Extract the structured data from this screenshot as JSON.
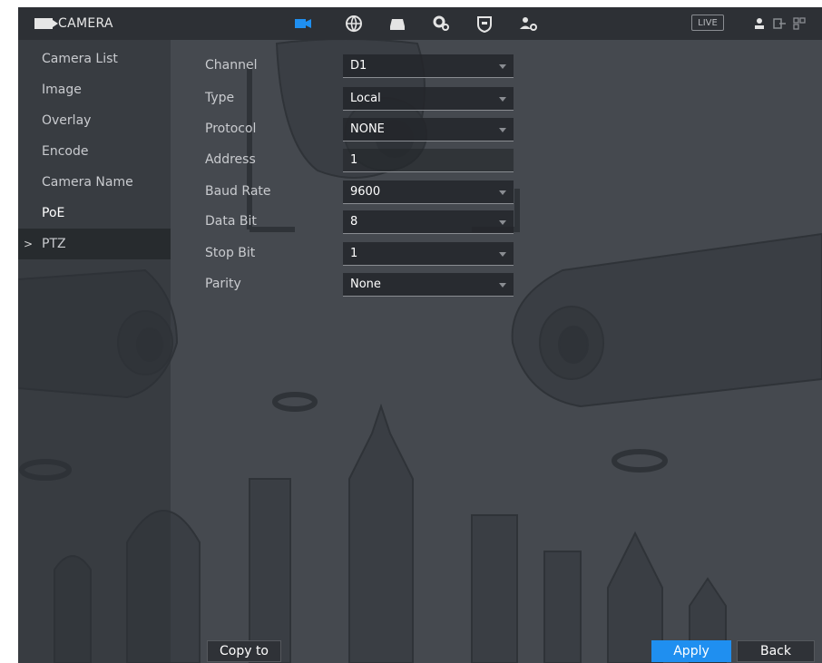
{
  "header": {
    "title": "CAMERA",
    "live_label": "LIVE"
  },
  "top_nav": [
    {
      "icon": "camera-icon",
      "active": true
    },
    {
      "icon": "network-icon"
    },
    {
      "icon": "storage-icon"
    },
    {
      "icon": "system-settings-icon"
    },
    {
      "icon": "security-shield-icon"
    },
    {
      "icon": "account-icon"
    }
  ],
  "sidebar": {
    "items": [
      {
        "label": "Camera List"
      },
      {
        "label": "Image"
      },
      {
        "label": "Overlay"
      },
      {
        "label": "Encode"
      },
      {
        "label": "Camera Name"
      },
      {
        "label": "PoE"
      },
      {
        "label": "PTZ",
        "selected": true
      }
    ],
    "selected_marker": ">"
  },
  "form": {
    "channel": {
      "label": "Channel",
      "value": "D1"
    },
    "type": {
      "label": "Type",
      "value": "Local"
    },
    "protocol": {
      "label": "Protocol",
      "value": "NONE"
    },
    "address": {
      "label": "Address",
      "value": "1"
    },
    "baud_rate": {
      "label": "Baud Rate",
      "value": "9600"
    },
    "data_bit": {
      "label": "Data Bit",
      "value": "8"
    },
    "stop_bit": {
      "label": "Stop Bit",
      "value": "1"
    },
    "parity": {
      "label": "Parity",
      "value": "None"
    }
  },
  "buttons": {
    "copy_to": "Copy to",
    "apply": "Apply",
    "back": "Back"
  },
  "colors": {
    "accent": "#1f8ff0",
    "background": "#45494f",
    "topbar": "#2d3035"
  }
}
